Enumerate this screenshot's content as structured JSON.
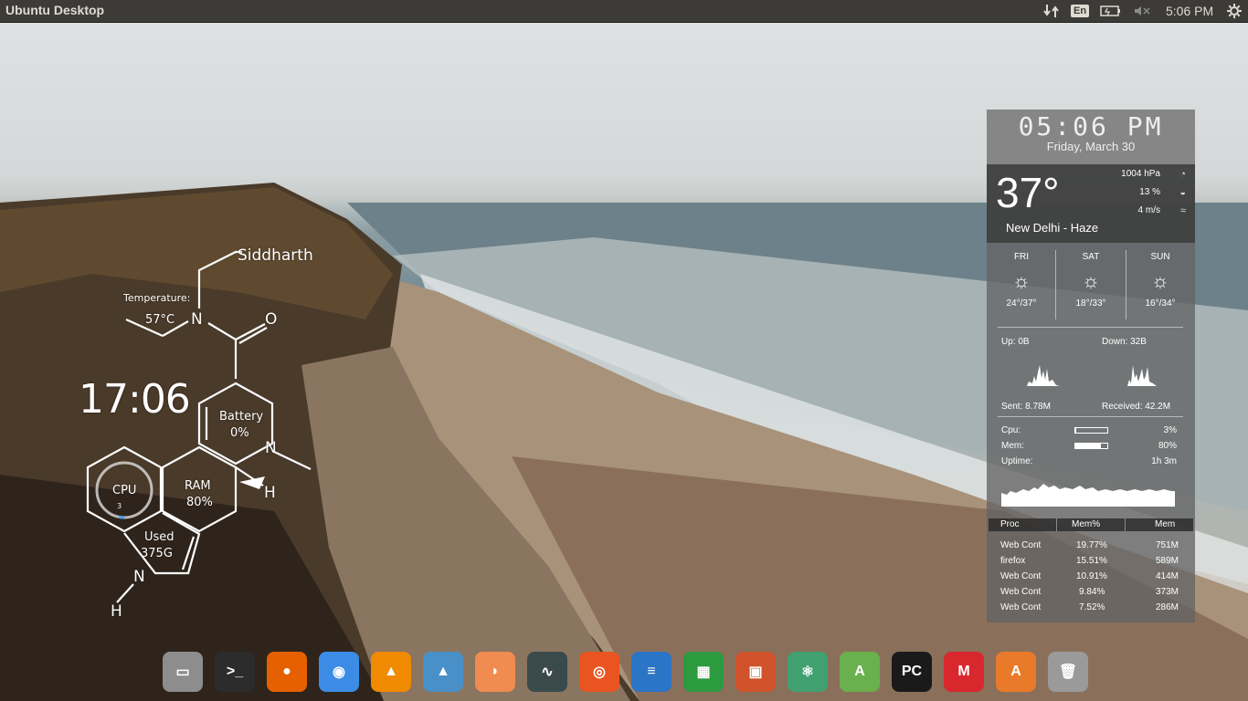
{
  "top_panel": {
    "title": "Ubuntu Desktop",
    "language": "En",
    "clock": "5:06 PM"
  },
  "conky_left": {
    "user": "Siddharth",
    "temperature_label": "Temperature:",
    "temperature_value": "57°C",
    "clock": "17:06",
    "battery_label": "Battery",
    "battery_value": "0%",
    "cpu_label": "CPU",
    "cpu_value": "3",
    "ram_label": "RAM",
    "ram_value": "80%",
    "used_label": "Used",
    "used_value": "375G",
    "atom_n1": "N",
    "atom_n2": "N",
    "atom_n3": "N",
    "atom_o": "O",
    "atom_h1": "H",
    "atom_h2": "H"
  },
  "conky_right": {
    "time": "05:06 PM",
    "date": "Friday, March 30",
    "temperature": "37°",
    "location": "New Delhi - Haze",
    "pressure": "1004 hPa",
    "humidity": "13 %",
    "wind": "4 m/s",
    "forecast": [
      {
        "day": "FRI",
        "range": "24°/37°"
      },
      {
        "day": "SAT",
        "range": "18°/33°"
      },
      {
        "day": "SUN",
        "range": "16°/34°"
      }
    ],
    "net": {
      "up": "Up: 0B",
      "down": "Down: 32B",
      "sent": "Sent: 8.78M",
      "received": "Received: 42.2M"
    },
    "system": {
      "cpu_label": "Cpu:",
      "cpu_value": "3%",
      "cpu_fraction": 0.03,
      "mem_label": "Mem:",
      "mem_value": "80%",
      "mem_fraction": 0.8,
      "uptime_label": "Uptime:",
      "uptime_value": "1h 3m"
    },
    "proc_headers": [
      "Proc",
      "Mem%",
      "Mem"
    ],
    "processes": [
      {
        "name": "Web Cont",
        "pct": "19.77%",
        "mem": "751M"
      },
      {
        "name": "firefox",
        "pct": "15.51%",
        "mem": "589M"
      },
      {
        "name": "Web Cont",
        "pct": "10.91%",
        "mem": "414M"
      },
      {
        "name": "Web Cont",
        "pct": "9.84%",
        "mem": "373M"
      },
      {
        "name": "Web Cont",
        "pct": "7.52%",
        "mem": "286M"
      }
    ]
  },
  "dock": {
    "items": [
      {
        "icon": "files-icon",
        "glyph": "▭",
        "color": "#8d8d8d"
      },
      {
        "icon": "terminal-icon",
        "glyph": ">_",
        "color": "#2c2c2c"
      },
      {
        "icon": "firefox-icon",
        "glyph": "●",
        "color": "#e66000"
      },
      {
        "icon": "chrome-icon",
        "glyph": "◉",
        "color": "#3c8ce6"
      },
      {
        "icon": "vlc-icon",
        "glyph": "▲",
        "color": "#f08a00"
      },
      {
        "icon": "vlc-media-icon",
        "glyph": "▲",
        "color": "#4a90c8"
      },
      {
        "icon": "clementine-icon",
        "glyph": "◗",
        "color": "#f08c50"
      },
      {
        "icon": "system-monitor-icon",
        "glyph": "∿",
        "color": "#3a4a4a"
      },
      {
        "icon": "ubuntu-software-icon",
        "glyph": "◎",
        "color": "#e95420"
      },
      {
        "icon": "libreoffice-writer-icon",
        "glyph": "≡",
        "color": "#2a75c6"
      },
      {
        "icon": "libreoffice-calc-icon",
        "glyph": "▦",
        "color": "#2c9b40"
      },
      {
        "icon": "libreoffice-impress-icon",
        "glyph": "▣",
        "color": "#d0532c"
      },
      {
        "icon": "atom-icon",
        "glyph": "⚛",
        "color": "#40a070"
      },
      {
        "icon": "android-studio-icon",
        "glyph": "A",
        "color": "#6ab04c"
      },
      {
        "icon": "pycharm-icon",
        "glyph": "PC",
        "color": "#1a1a1a"
      },
      {
        "icon": "mega-icon",
        "glyph": "M",
        "color": "#d9272e"
      },
      {
        "icon": "software-center-icon",
        "glyph": "A",
        "color": "#e87a2a"
      },
      {
        "icon": "trash-icon",
        "glyph": "🗑",
        "color": "#9a9a9a"
      }
    ]
  }
}
